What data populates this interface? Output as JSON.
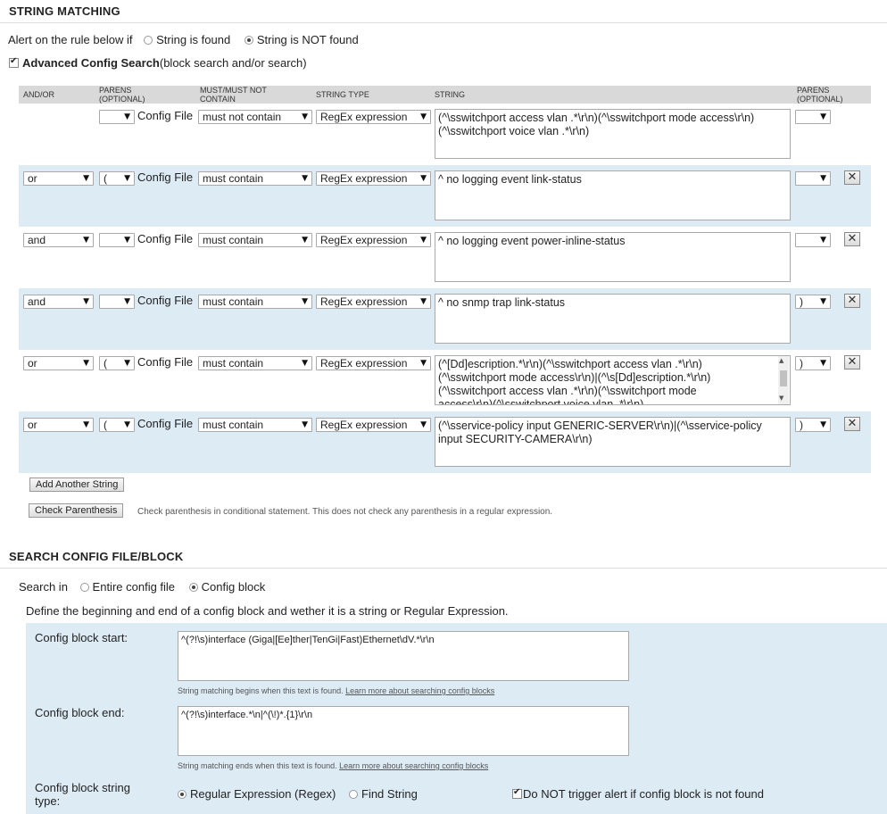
{
  "string_matching": {
    "title": "STRING MATCHING",
    "alert_prefix": "Alert on the rule below if",
    "alert_options": [
      {
        "label": "String is found",
        "selected": false
      },
      {
        "label": "String is NOT found",
        "selected": true
      }
    ],
    "advanced_checked": true,
    "advanced_label": "Advanced Config Search",
    "advanced_suffix": "(block search and/or search)",
    "columns": {
      "andor": "AND/OR",
      "parens1": "PARENS (OPTIONAL)",
      "must": "MUST/MUST NOT CONTAIN",
      "type": "STRING TYPE",
      "string": "STRING",
      "parens2": "PARENS (OPTIONAL)"
    },
    "rows": [
      {
        "andor": "",
        "paren_open": "",
        "source": "Config File",
        "must": "must not contain",
        "type": "RegEx expression",
        "string": "(^\\sswitchport access vlan .*\\r\\n)(^\\sswitchport mode access\\r\\n)\n(^\\sswitchport voice vlan .*\\r\\n)",
        "paren_close": ""
      },
      {
        "andor": "or",
        "paren_open": "(",
        "source": "Config File",
        "must": "must contain",
        "type": "RegEx expression",
        "string": "^ no logging event link-status",
        "paren_close": ""
      },
      {
        "andor": "and",
        "paren_open": "",
        "source": "Config File",
        "must": "must contain",
        "type": "RegEx expression",
        "string": "^ no logging event power-inline-status",
        "paren_close": ""
      },
      {
        "andor": "and",
        "paren_open": "",
        "source": "Config File",
        "must": "must contain",
        "type": "RegEx expression",
        "string": "^ no snmp trap link-status",
        "paren_close": ")"
      },
      {
        "andor": "or",
        "paren_open": "(",
        "source": "Config File",
        "must": "must contain",
        "type": "RegEx expression",
        "string": "(^[Dd]escription.*\\r\\n)(^\\sswitchport access vlan .*\\r\\n)\n(^\\sswitchport mode access\\r\\n)|(^\\s[Dd]escription.*\\r\\n)\n(^\\sswitchport access vlan .*\\r\\n)(^\\sswitchport mode\naccess\\r\\n)(^\\sswitchport voice vlan .*\\r\\n)",
        "paren_close": ")"
      },
      {
        "andor": "or",
        "paren_open": "(",
        "source": "Config File",
        "must": "must contain",
        "type": "RegEx expression",
        "string": "(^\\sservice-policy input GENERIC-SERVER\\r\\n)|(^\\sservice-policy\ninput SECURITY-CAMERA\\r\\n)",
        "paren_close": ")"
      }
    ],
    "remove_glyph": "✕",
    "add_button": "Add Another String",
    "check_button": "Check Parenthesis",
    "check_note": "Check parenthesis in conditional statement. This does not check any parenthesis in a regular expression."
  },
  "search_config": {
    "title": "SEARCH CONFIG FILE/BLOCK",
    "search_in_label": "Search in",
    "search_options": [
      {
        "label": "Entire config file",
        "selected": false
      },
      {
        "label": "Config block",
        "selected": true
      }
    ],
    "define_text": "Define the beginning and end of a config block and wether it is a string or Regular Expression.",
    "block_start_label": "Config block start:",
    "block_start_value": "^(?!\\s)interface (Giga|[Ee]ther|TenGi|Fast)Ethernet\\dV.*\\r\\n",
    "block_start_hint": "String matching begins when this text is found.",
    "block_start_link": "Learn more about searching config blocks",
    "block_end_label": "Config block end:",
    "block_end_value": "^(?!\\s)interface.*\\n|^(\\!)*.{1}\\r\\n",
    "block_end_hint": "String matching ends when this text is found.",
    "block_end_link": "Learn more about searching config blocks",
    "string_type_label_1": "Config block string",
    "string_type_label_2": "type:",
    "type_options": [
      {
        "label": "Regular Expression (Regex)",
        "selected": true
      },
      {
        "label": "Find String",
        "selected": false
      }
    ],
    "no_trigger_checked": true,
    "no_trigger_label": "Do NOT trigger alert if config block is not found"
  }
}
